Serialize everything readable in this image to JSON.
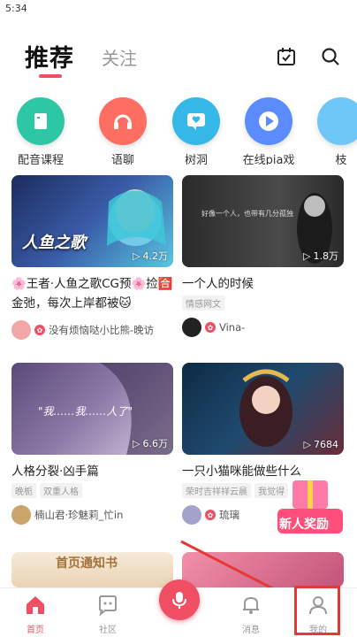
{
  "status": {
    "time": "5:34"
  },
  "header": {
    "tab_recommend": "推荐",
    "tab_follow": "关注"
  },
  "categories": [
    {
      "label": "配音课程",
      "icon": "book-icon",
      "color": "#2ec7a6"
    },
    {
      "label": "语聊",
      "icon": "headphones-icon",
      "color": "#ff6f61"
    },
    {
      "label": "树洞",
      "icon": "heart-chat-icon",
      "color": "#35b8e8"
    },
    {
      "label": "在线pia戏",
      "icon": "play-icon",
      "color": "#5b8cff"
    },
    {
      "label": "枝",
      "icon": "more-icon",
      "color": "#6fc7f7"
    }
  ],
  "cards": [
    {
      "title": "🌸王者·人鱼之歌CG预🌸捡🈴金弛，每次上岸都被🐱",
      "thumb_text": "人鱼之歌",
      "plays": "4.2万",
      "author": "没有烦恼哒小比熊-晚访",
      "tags": []
    },
    {
      "title": "一个人的时候",
      "thumb_text": "好像一个人，也带有几分孤独",
      "plays": "1.8万",
      "author": "Vina-",
      "tags": [
        "情感网文"
      ]
    },
    {
      "title": "人格分裂·凶手篇",
      "thumb_text": "\"我……我……人了\"",
      "plays": "6.6万",
      "author": "楠山君·珍魅莉_忙in",
      "tags": [
        "晚栀",
        "双重人格"
      ]
    },
    {
      "title": "一只小猫咪能做些什么",
      "thumb_text": "",
      "plays": "7684",
      "author": "琉璃",
      "tags": [
        "荣时吉祥祥云晨",
        "我觉得"
      ]
    },
    {
      "title": "",
      "thumb_text": "首页通知书",
      "plays": "",
      "author": "",
      "tags": []
    }
  ],
  "promo": {
    "label": "新人奖励"
  },
  "tabbar": {
    "home": "首页",
    "community": "社区",
    "messages": "消息",
    "mine": "我的"
  },
  "colors": {
    "accent": "#f04f63",
    "highlight": "#e53935"
  }
}
